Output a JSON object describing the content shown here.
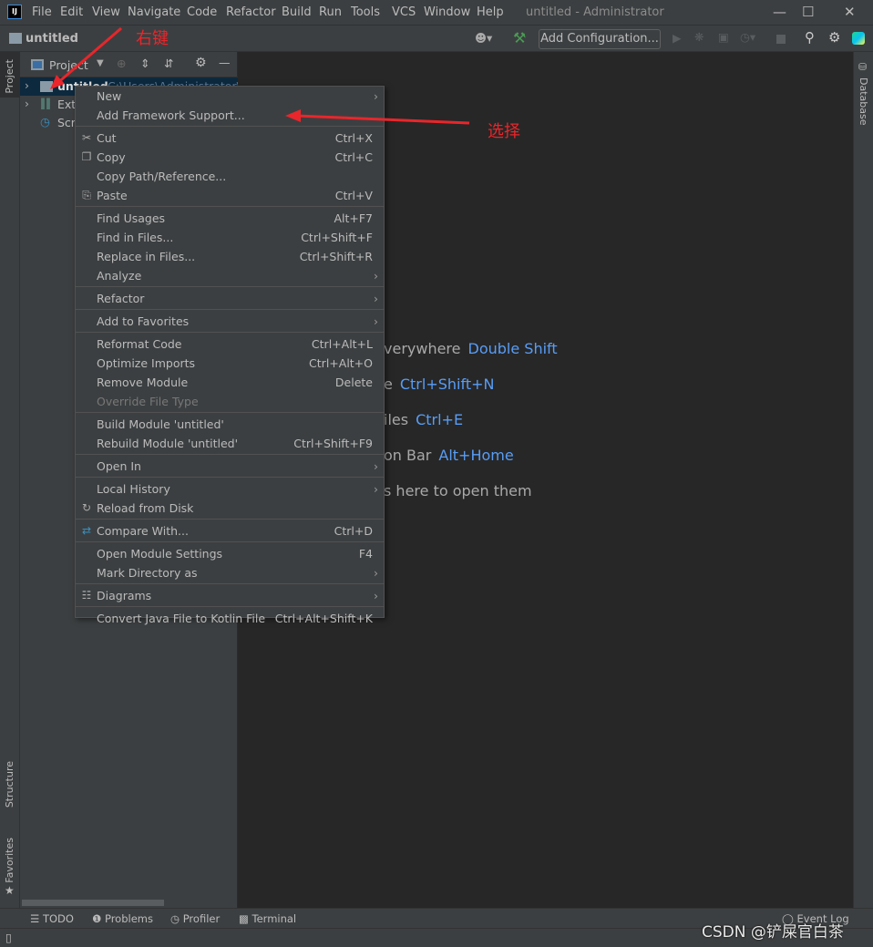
{
  "titlebar": {
    "menus": [
      "File",
      "Edit",
      "View",
      "Navigate",
      "Code",
      "Refactor",
      "Build",
      "Run",
      "Tools",
      "VCS",
      "Window",
      "Help"
    ],
    "title": "untitled - Administrator"
  },
  "navbar": {
    "project": "untitled",
    "add_configuration": "Add Configuration..."
  },
  "left_tabs": {
    "project": "Project",
    "structure": "Structure",
    "favorites": "Favorites"
  },
  "right_tabs": {
    "database": "Database"
  },
  "project_panel": {
    "title": "Project",
    "tree": [
      {
        "label": "untitled",
        "path": "C:\\Users\\Administrator\\"
      },
      {
        "label": "Ext"
      },
      {
        "label": "Scr"
      }
    ]
  },
  "editor_hints": [
    {
      "text": "verywhere",
      "key": "Double Shift"
    },
    {
      "text": "e",
      "key": "Ctrl+Shift+N"
    },
    {
      "text": "iles",
      "key": "Ctrl+E"
    },
    {
      "text": "on Bar",
      "key": "Alt+Home"
    },
    {
      "text": "s here to open them",
      "key": ""
    }
  ],
  "context_menu": [
    [
      {
        "label": "New",
        "submenu": true
      },
      {
        "label": "Add Framework Support..."
      }
    ],
    [
      {
        "label": "Cut",
        "shortcut": "Ctrl+X",
        "icon": "scissors-icon"
      },
      {
        "label": "Copy",
        "shortcut": "Ctrl+C",
        "icon": "copy-icon"
      },
      {
        "label": "Copy Path/Reference..."
      },
      {
        "label": "Paste",
        "shortcut": "Ctrl+V",
        "icon": "paste-icon"
      }
    ],
    [
      {
        "label": "Find Usages",
        "shortcut": "Alt+F7"
      },
      {
        "label": "Find in Files...",
        "shortcut": "Ctrl+Shift+F"
      },
      {
        "label": "Replace in Files...",
        "shortcut": "Ctrl+Shift+R"
      },
      {
        "label": "Analyze",
        "submenu": true
      }
    ],
    [
      {
        "label": "Refactor",
        "submenu": true
      }
    ],
    [
      {
        "label": "Add to Favorites",
        "submenu": true
      }
    ],
    [
      {
        "label": "Reformat Code",
        "shortcut": "Ctrl+Alt+L"
      },
      {
        "label": "Optimize Imports",
        "shortcut": "Ctrl+Alt+O"
      },
      {
        "label": "Remove Module",
        "shortcut": "Delete"
      },
      {
        "label": "Override File Type",
        "disabled": true
      }
    ],
    [
      {
        "label": "Build Module 'untitled'"
      },
      {
        "label": "Rebuild Module 'untitled'",
        "shortcut": "Ctrl+Shift+F9"
      }
    ],
    [
      {
        "label": "Open In",
        "submenu": true
      }
    ],
    [
      {
        "label": "Local History",
        "submenu": true
      },
      {
        "label": "Reload from Disk",
        "icon": "reload-icon"
      }
    ],
    [
      {
        "label": "Compare With...",
        "shortcut": "Ctrl+D",
        "icon": "compare-icon"
      }
    ],
    [
      {
        "label": "Open Module Settings",
        "shortcut": "F4"
      },
      {
        "label": "Mark Directory as",
        "submenu": true
      }
    ],
    [
      {
        "label": "Diagrams",
        "submenu": true,
        "icon": "diagram-icon"
      }
    ],
    [
      {
        "label": "Convert Java File to Kotlin File",
        "shortcut": "Ctrl+Alt+Shift+K"
      }
    ]
  ],
  "bottom_tabs": [
    "TODO",
    "Problems",
    "Profiler",
    "Terminal"
  ],
  "event_log": "Event Log",
  "annotations": {
    "right_click": "右键",
    "select": "选择",
    "annotation_color": "#e8262b"
  },
  "watermark": "CSDN @铲屎官白茶"
}
